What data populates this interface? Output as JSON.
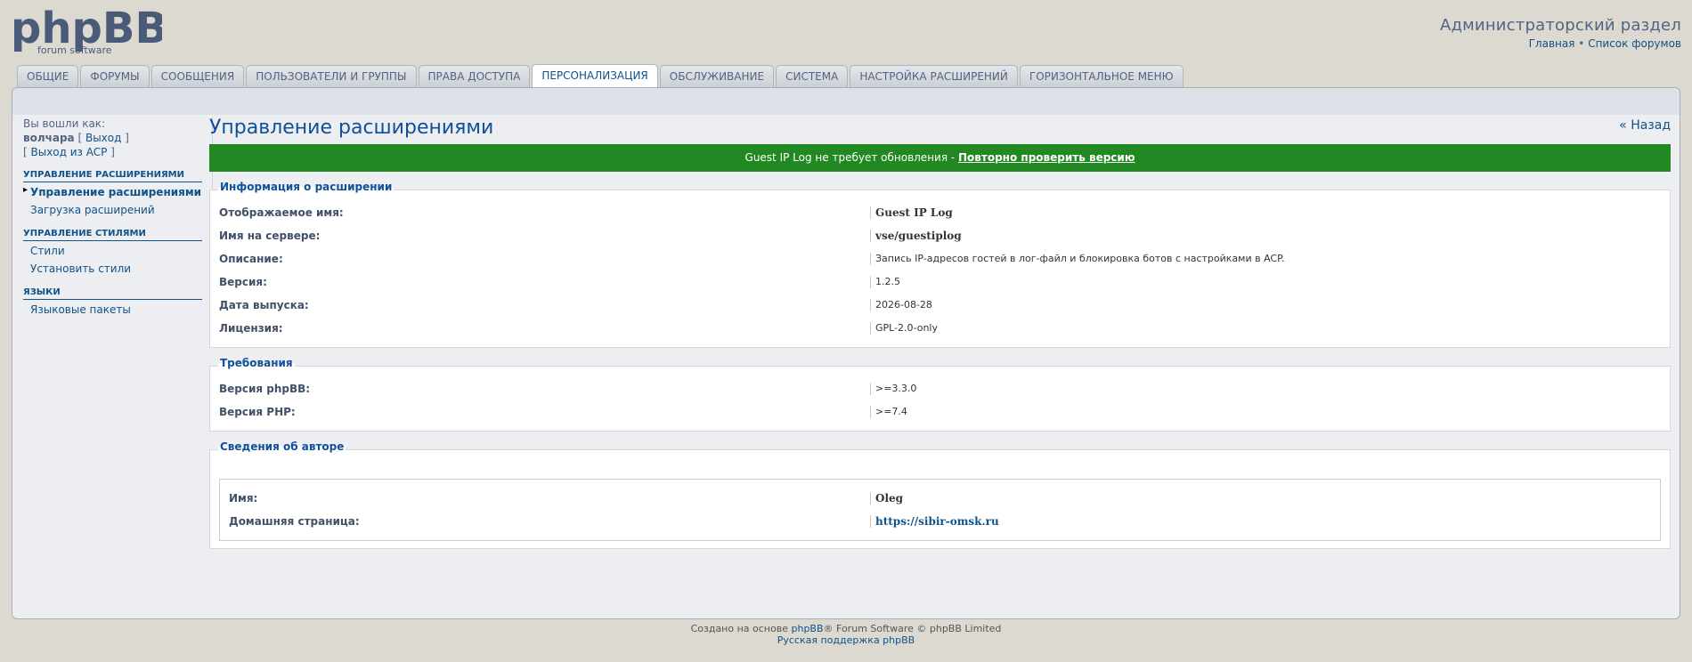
{
  "header": {
    "logo_text": "phpBB",
    "logo_sub": "forum software",
    "title": "Администраторский раздел",
    "link_home": "Главная",
    "separator": "•",
    "link_forums": "Список форумов"
  },
  "tabs": [
    {
      "label": "Общие"
    },
    {
      "label": "Форумы"
    },
    {
      "label": "Сообщения"
    },
    {
      "label": "Пользователи и группы"
    },
    {
      "label": "Права доступа"
    },
    {
      "label": "Персонализация",
      "active": true
    },
    {
      "label": "Обслуживание"
    },
    {
      "label": "Система"
    },
    {
      "label": "Настройка расширений"
    },
    {
      "label": "Горизонтальное меню"
    }
  ],
  "sidebar": {
    "logged_as": "Вы вошли как:",
    "username": "волчара",
    "logout": "Выход",
    "acp_logout": "Выход из ACP",
    "groups": [
      {
        "title": "Управление расширениями",
        "items": [
          "Управление расширениями",
          "Загрузка расширений"
        ]
      },
      {
        "title": "Управление стилями",
        "items": [
          "Стили",
          "Установить стили"
        ]
      },
      {
        "title": "Языки",
        "items": [
          "Языковые пакеты"
        ]
      }
    ]
  },
  "content": {
    "title": "Управление расширениями",
    "back": "« Назад",
    "status_text": "Guest IP Log не требует обновления - ",
    "status_link": "Повторно проверить версию",
    "info": {
      "legend": "Информация о расширении",
      "rows": [
        {
          "label": "Отображаемое имя:",
          "value": "Guest IP Log"
        },
        {
          "label": "Имя на сервере:",
          "value": "vse/guestiplog"
        },
        {
          "label": "Описание:",
          "value": "Запись IP-адресов гостей в лог-файл и блокировка ботов с настройками в ACP."
        },
        {
          "label": "Версия:",
          "value": "1.2.5"
        },
        {
          "label": "Дата выпуска:",
          "value": "2026-08-28"
        },
        {
          "label": "Лицензия:",
          "value": "GPL-2.0-only"
        }
      ]
    },
    "requirements": {
      "legend": "Требования",
      "rows": [
        {
          "label": "Версия phpBB:",
          "value": ">=3.3.0"
        },
        {
          "label": "Версия PHP:",
          "value": ">=7.4"
        }
      ]
    },
    "author": {
      "legend": "Сведения об авторе",
      "rows": [
        {
          "label": "Имя:",
          "value": "Oleg"
        },
        {
          "label": "Домашняя страница:",
          "value": "https://sibir-omsk.ru"
        }
      ]
    }
  },
  "footer": {
    "line1_prefix": "Создано на основе ",
    "line1_link": "phpBB",
    "line1_suffix": "® Forum Software © phpBB Limited",
    "line2": "Русская поддержка phpBB"
  },
  "colors": {
    "accent": "#105289",
    "success": "#228822",
    "background": "#dcd9d1"
  }
}
